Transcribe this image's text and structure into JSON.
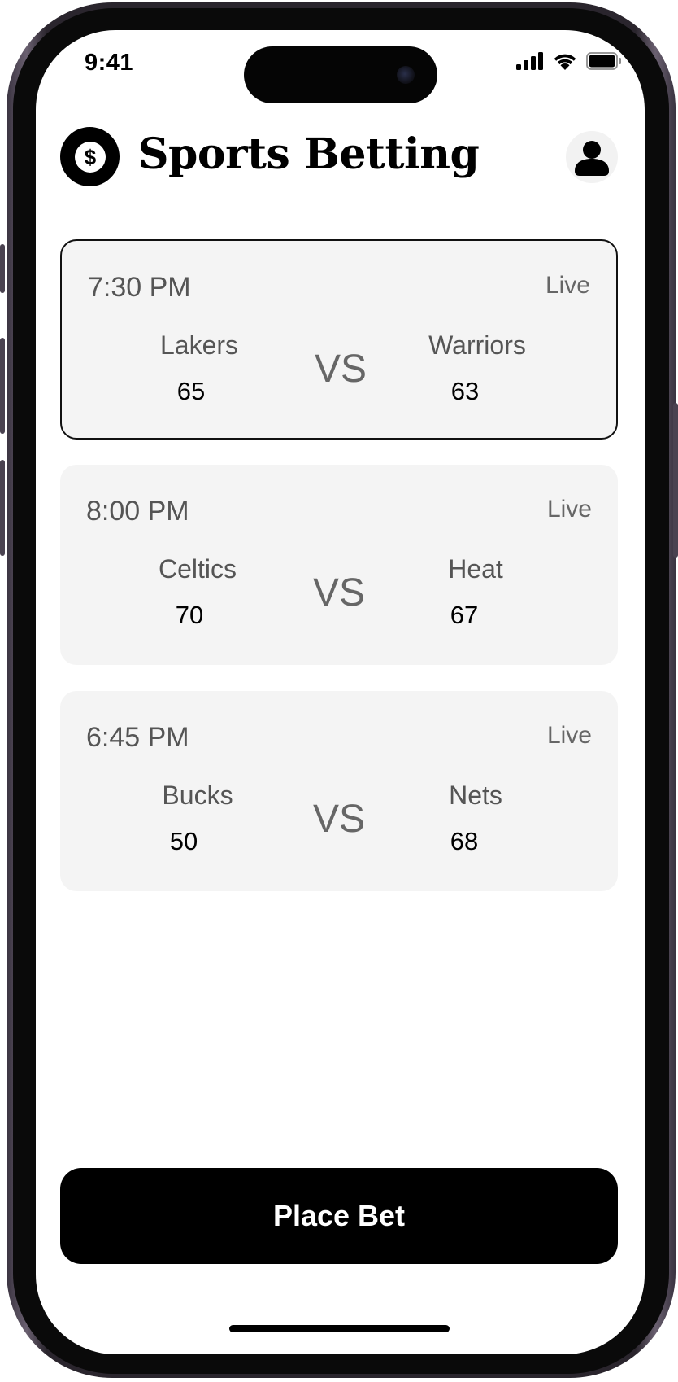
{
  "status_bar": {
    "time": "9:41"
  },
  "header": {
    "title": "Sports Betting"
  },
  "games": [
    {
      "time": "7:30 PM",
      "status": "Live",
      "home": {
        "name": "Lakers",
        "score": "65"
      },
      "away": {
        "name": "Warriors",
        "score": "63"
      },
      "vs": "VS",
      "selected": true
    },
    {
      "time": "8:00 PM",
      "status": "Live",
      "home": {
        "name": "Celtics",
        "score": "70"
      },
      "away": {
        "name": "Heat",
        "score": "67"
      },
      "vs": "VS",
      "selected": false
    },
    {
      "time": "6:45 PM",
      "status": "Live",
      "home": {
        "name": "Bucks",
        "score": "50"
      },
      "away": {
        "name": "Nets",
        "score": "68"
      },
      "vs": "VS",
      "selected": false
    }
  ],
  "action": {
    "place_bet_label": "Place Bet"
  },
  "icons": {
    "logo": "dollar-icon",
    "profile": "user-icon"
  },
  "colors": {
    "primary": "#000000",
    "card_bg": "#f4f4f4",
    "muted_text": "#555555"
  }
}
